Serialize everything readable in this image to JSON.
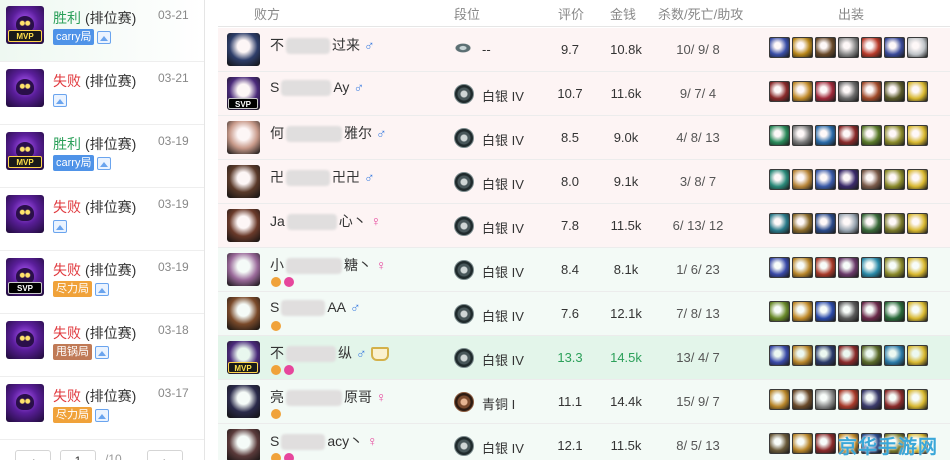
{
  "matches": [
    {
      "result": "胜利",
      "result_type": "win",
      "mode": "(排位赛)",
      "date": "03-21",
      "badge": "MVP",
      "tag": "carry局",
      "tag_color": "blue",
      "active": true
    },
    {
      "result": "失败",
      "result_type": "lose",
      "mode": "(排位赛)",
      "date": "03-21",
      "badge": "",
      "tag": "",
      "tag_color": "",
      "active": false
    },
    {
      "result": "胜利",
      "result_type": "win",
      "mode": "(排位赛)",
      "date": "03-19",
      "badge": "MVP",
      "tag": "carry局",
      "tag_color": "blue",
      "active": false
    },
    {
      "result": "失败",
      "result_type": "lose",
      "mode": "(排位赛)",
      "date": "03-19",
      "badge": "",
      "tag": "",
      "tag_color": "",
      "active": false
    },
    {
      "result": "失败",
      "result_type": "lose",
      "mode": "(排位赛)",
      "date": "03-19",
      "badge": "SVP",
      "tag": "尽力局",
      "tag_color": "orange",
      "active": false
    },
    {
      "result": "失败",
      "result_type": "lose",
      "mode": "(排位赛)",
      "date": "03-18",
      "badge": "",
      "tag": "甩锅局",
      "tag_color": "brown",
      "active": false
    },
    {
      "result": "失败",
      "result_type": "lose",
      "mode": "(排位赛)",
      "date": "03-17",
      "badge": "",
      "tag": "尽力局",
      "tag_color": "orange",
      "active": false
    }
  ],
  "pager": {
    "prev": "‹",
    "current": "1",
    "total": "/10",
    "next": "›"
  },
  "headers": {
    "player": "败方",
    "rank": "段位",
    "score": "评价",
    "gold": "金钱",
    "kda": "杀数/死亡/助攻",
    "items": "出装"
  },
  "players": [
    {
      "name_pre": "不",
      "name_post": "过来",
      "gender": "♂",
      "badge": "",
      "rank": "--",
      "rank_style": "wing",
      "score": "9.7",
      "gold": "10.8k",
      "k": "10",
      "d": "9",
      "a": "8",
      "side": "lose",
      "me": false,
      "hero_color": "#2e3e6a",
      "items": [
        "#3a4fa8",
        "#b8861a",
        "#6a4a2a",
        "#8a8a8a",
        "#b83a2a",
        "#3a4a9a",
        "#c0c4c8"
      ]
    },
    {
      "name_pre": "S",
      "name_post": "Ay",
      "gender": "♂",
      "badge": "SVP",
      "rank": "白银 IV",
      "rank_style": "silver",
      "score": "10.7",
      "gold": "11.6k",
      "k": "9",
      "d": "7",
      "a": "4",
      "side": "lose",
      "me": false,
      "hero_color": "#4a2a7a",
      "items": [
        "#8a2a2a",
        "#c08a2a",
        "#a02a3a",
        "#6a6a6a",
        "#a04a2a",
        "#5a5a2a",
        "#d8b830"
      ]
    },
    {
      "name_pre": "何",
      "name_post": "雅尔",
      "gender": "♂",
      "badge": "",
      "rank": "白银 IV",
      "rank_style": "silver",
      "score": "8.5",
      "gold": "9.0k",
      "k": "4",
      "d": "8",
      "a": "13",
      "side": "lose",
      "me": false,
      "hero_color": "#c89a8a",
      "items": [
        "#2a8a5a",
        "#7a7a7a",
        "#2a6aa8",
        "#8a2a2a",
        "#5a7a2a",
        "#8a8a2a",
        "#d8b830"
      ]
    },
    {
      "name_pre": "卍",
      "name_post": "卍卍",
      "gender": "♂",
      "badge": "",
      "rank": "白银 IV",
      "rank_style": "silver",
      "score": "8.0",
      "gold": "9.1k",
      "k": "3",
      "d": "8",
      "a": "7",
      "side": "lose",
      "me": false,
      "hero_color": "#5a3a2a",
      "items": [
        "#2a8a7a",
        "#b8863a",
        "#3a5aa8",
        "#3a2a6a",
        "#7a5a4a",
        "#8a8a2a",
        "#d8b830"
      ]
    },
    {
      "name_pre": "Ja",
      "name_post": "心丶",
      "gender": "♀",
      "badge": "",
      "rank": "白银 IV",
      "rank_style": "silver",
      "score": "7.8",
      "gold": "11.5k",
      "k": "6",
      "d": "13",
      "a": "12",
      "side": "lose",
      "me": false,
      "hero_color": "#6a3a2a",
      "items": [
        "#2a7a8a",
        "#8a6a2a",
        "#2a4a8a",
        "#9aa6b2",
        "#3a6a3a",
        "#7a7a2a",
        "#d8b830"
      ]
    },
    {
      "name_pre": "小",
      "name_post": "糖丶",
      "gender": "♀",
      "badge": "",
      "rank": "白银 IV",
      "rank_style": "silver",
      "score": "8.4",
      "gold": "8.1k",
      "k": "1",
      "d": "6",
      "a": "23",
      "side": "win",
      "me": false,
      "hero_color": "#9a6a9a",
      "items": [
        "#3a4aa8",
        "#b8862a",
        "#a83a2a",
        "#6a3a6a",
        "#2a8aa8",
        "#8a8a2a",
        "#d8b830"
      ]
    },
    {
      "name_pre": "S",
      "name_post": "AA",
      "gender": "♂",
      "badge": "",
      "rank": "白银 IV",
      "rank_style": "silver",
      "score": "7.6",
      "gold": "12.1k",
      "k": "7",
      "d": "8",
      "a": "13",
      "side": "win",
      "me": false,
      "hero_color": "#7a4a2a",
      "items": [
        "#6a8a2a",
        "#c08a2a",
        "#2a4aa8",
        "#5a5a5a",
        "#6a2a4a",
        "#2a6a3a",
        "#d8b830"
      ]
    },
    {
      "name_pre": "不",
      "name_post": "纵",
      "gender": "♂",
      "badge": "MVP",
      "rank": "白银 IV",
      "rank_style": "silver",
      "score": "13.3",
      "gold": "14.5k",
      "k": "13",
      "d": "4",
      "a": "7",
      "side": "win",
      "me": true,
      "hero_color": "#4a2a7a",
      "items": [
        "#3a4aa8",
        "#b8862a",
        "#2a3a6a",
        "#8a2a2a",
        "#5a6a2a",
        "#2a7aa8",
        "#d8b830"
      ]
    },
    {
      "name_pre": "亮",
      "name_post": "原哥",
      "gender": "♀",
      "badge": "",
      "rank": "青铜 I",
      "rank_style": "bronze",
      "score": "11.1",
      "gold": "14.4k",
      "k": "15",
      "d": "9",
      "a": "7",
      "side": "win",
      "me": false,
      "hero_color": "#2a2a4a",
      "items": [
        "#b8862a",
        "#6a4a2a",
        "#8a8a8a",
        "#a83a2a",
        "#3a3a6a",
        "#8a2a2a",
        "#d8b830"
      ]
    },
    {
      "name_pre": "S",
      "name_post": "acy丶",
      "gender": "♀",
      "badge": "",
      "rank": "白银 IV",
      "rank_style": "silver",
      "score": "12.1",
      "gold": "11.5k",
      "k": "8",
      "d": "5",
      "a": "13",
      "side": "win",
      "me": false,
      "hero_color": "#5a3a3a",
      "items": [
        "#6a5a3a",
        "#b8862a",
        "#8a2a2a",
        "#c08a2a",
        "#2a4a8a",
        "#7a7a2a",
        "#d8b830"
      ]
    }
  ],
  "watermark": "京华手游网"
}
